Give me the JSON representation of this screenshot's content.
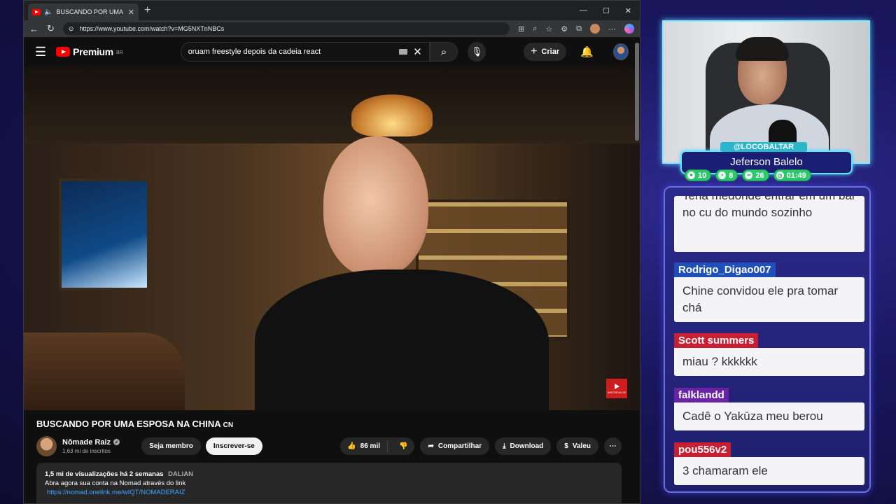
{
  "browser": {
    "tab_title": "BUSCANDO POR UMA ESPOSA",
    "url": "https://www.youtube.com/watch?v=MG5NXTnNBCs"
  },
  "youtube": {
    "logo_text": "Premium",
    "region": "BR",
    "search_query": "oruam freestyle depois da cadeia react",
    "create_label": "Criar"
  },
  "video": {
    "title": "BUSCANDO POR UMA ESPOSA NA CHINA",
    "flag": "CN",
    "watermark_label": "INSCREVA-SE"
  },
  "channel": {
    "name": "Nômade Raiz",
    "subscribers": "1,63 mi de inscritos",
    "member_label": "Seja membro",
    "subscribe_label": "Inscrever-se"
  },
  "actions": {
    "likes": "86 mil",
    "share": "Compartilhar",
    "download": "Download",
    "thanks": "Valeu"
  },
  "description": {
    "stats": "1,5 mi de visualizações  há 2 semanas",
    "tag": "DALIAN",
    "line1": "Abra agora sua conta na Nomad através do link",
    "link": "https://nomad.onelink.me/wIQT/NOMADERAIZ"
  },
  "streamer": {
    "handle": "@LOCOBALTAR",
    "name": "Jeferson Balelo",
    "stats": [
      {
        "icon": "viewers-icon",
        "value": "10"
      },
      {
        "icon": "chat-icon",
        "value": "8"
      },
      {
        "icon": "link-icon",
        "value": "26"
      },
      {
        "icon": "clock-icon",
        "value": "01:49"
      }
    ]
  },
  "chat": {
    "partial_message": "Teria medonde entrar em um bar no cu do mundo sozinho",
    "messages": [
      {
        "user": "Rodrigo_Digao007",
        "color": "#1f4fb8",
        "text": "Chine convidou ele pra tomar chá"
      },
      {
        "user": "Scott summers",
        "color": "#c81f33",
        "text": "miau ? kkkkkk"
      },
      {
        "user": "falklandd",
        "color": "#6a22a8",
        "text": "Cadê o Yakūza meu berou"
      },
      {
        "user": "pou556v2",
        "color": "#c81f33",
        "text": "3 chamaram ele"
      }
    ]
  }
}
